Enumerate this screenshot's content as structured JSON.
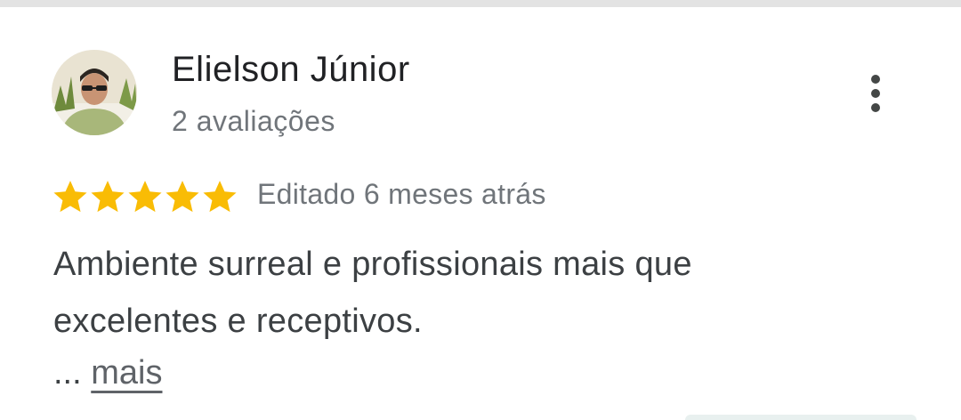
{
  "review": {
    "author_name": "Elielson Júnior",
    "review_count": "2 avaliações",
    "rating": 5,
    "rating_max": 5,
    "edited": "Editado 6 meses atrás",
    "text_line1": "Ambiente surreal e profissionais mais que",
    "text_line2": "excelentes e receptivos.",
    "ellipsis": "...",
    "more_label": "mais"
  },
  "colors": {
    "star": "#F9BC05",
    "name": "#202124",
    "secondary": "#70757A",
    "body": "#3C4043"
  },
  "icons": {
    "menu": "more-vert-icon",
    "star": "star-icon"
  }
}
